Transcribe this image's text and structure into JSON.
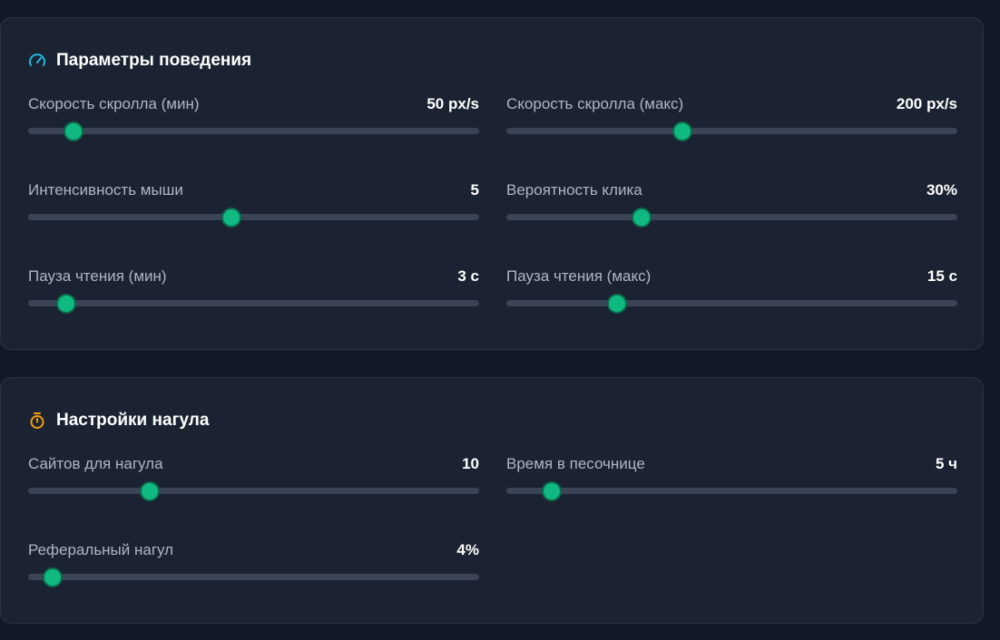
{
  "colors": {
    "background": "#111827",
    "card": "#1b2332",
    "accent": "#10b981",
    "behavior_icon": "#22b8e0",
    "warmup_icon": "#f59e0b"
  },
  "sections": [
    {
      "title": "Параметры поведения",
      "icon": "speedometer-icon",
      "fields": [
        {
          "label": "Скорость скролла (мин)",
          "value": "50 px/s",
          "level": 0.1
        },
        {
          "label": "Скорость скролла (макс)",
          "value": "200 px/s",
          "level": 0.39
        },
        {
          "label": "Интенсивность мыши",
          "value": "5",
          "level": 0.45
        },
        {
          "label": "Вероятность клика",
          "value": "30%",
          "level": 0.3
        },
        {
          "label": "Пауза чтения (мин)",
          "value": "3 с",
          "level": 0.085
        },
        {
          "label": "Пауза чтения (макс)",
          "value": "15 с",
          "level": 0.245
        }
      ]
    },
    {
      "title": "Настройки нагула",
      "icon": "stopwatch-icon",
      "fields": [
        {
          "label": "Сайтов для нагула",
          "value": "10",
          "level": 0.27
        },
        {
          "label": "Время в песочнице",
          "value": "5 ч",
          "level": 0.1
        },
        {
          "label": "Реферальный нагул",
          "value": "4%",
          "level": 0.055
        }
      ]
    }
  ]
}
